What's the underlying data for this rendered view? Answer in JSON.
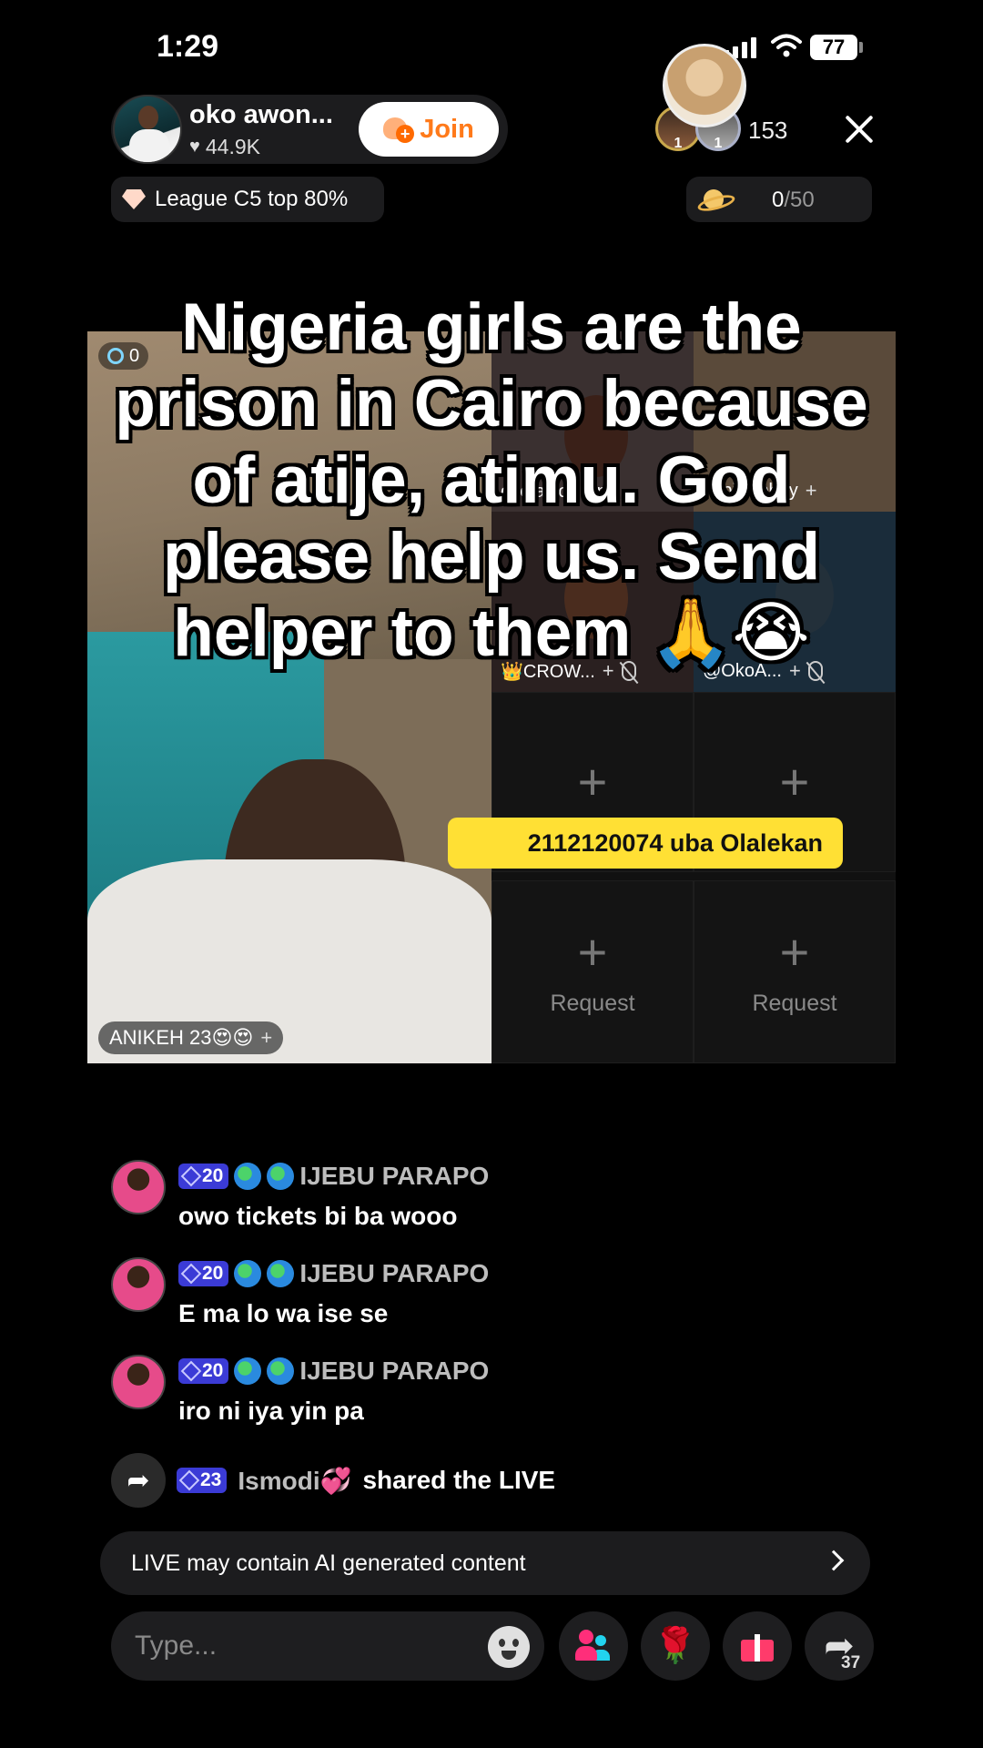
{
  "status_bar": {
    "time": "1:29",
    "battery": "77"
  },
  "host": {
    "name": "oko awon...",
    "likes": "44.9K",
    "join_label": "Join",
    "viewer_count": "153",
    "viewer_ranks": [
      "1",
      "1"
    ]
  },
  "league": {
    "label": "League C5 top 80%"
  },
  "planet": {
    "current": "0",
    "total": "/50"
  },
  "stream": {
    "counter": "0",
    "main_guest": "ANIKEH 23😍😍",
    "tiles": [
      {
        "name": "oko awon singl..."
      },
      {
        "name": "Abi_Abbey"
      },
      {
        "name": "👑CROW..."
      },
      {
        "name": "@OkoA..."
      }
    ],
    "request_label": "Request",
    "donation_banner": "2112120074 uba Olalekan"
  },
  "caption": "Nigeria girls are the prison in Cairo because of atije, atimu. God please help us. Send helper to them 🙏😭",
  "chat": [
    {
      "level": "20",
      "user": "IJEBU PARAPO",
      "text": "owo tickets bi ba wooo"
    },
    {
      "level": "20",
      "user": "IJEBU PARAPO",
      "text": "E ma lo wa ise se"
    },
    {
      "level": "20",
      "user": "IJEBU PARAPO",
      "text": "iro ni iya yin pa"
    }
  ],
  "share_event": {
    "level": "23",
    "user": "Ismodi💞",
    "action": "shared the LIVE"
  },
  "ai_notice": "LIVE may contain AI generated content",
  "composer": {
    "placeholder": "Type...",
    "share_count": "37"
  },
  "colors": {
    "join": "#ff7a1a",
    "level_badge": "#3b3bd6",
    "donation": "#ffe034"
  }
}
